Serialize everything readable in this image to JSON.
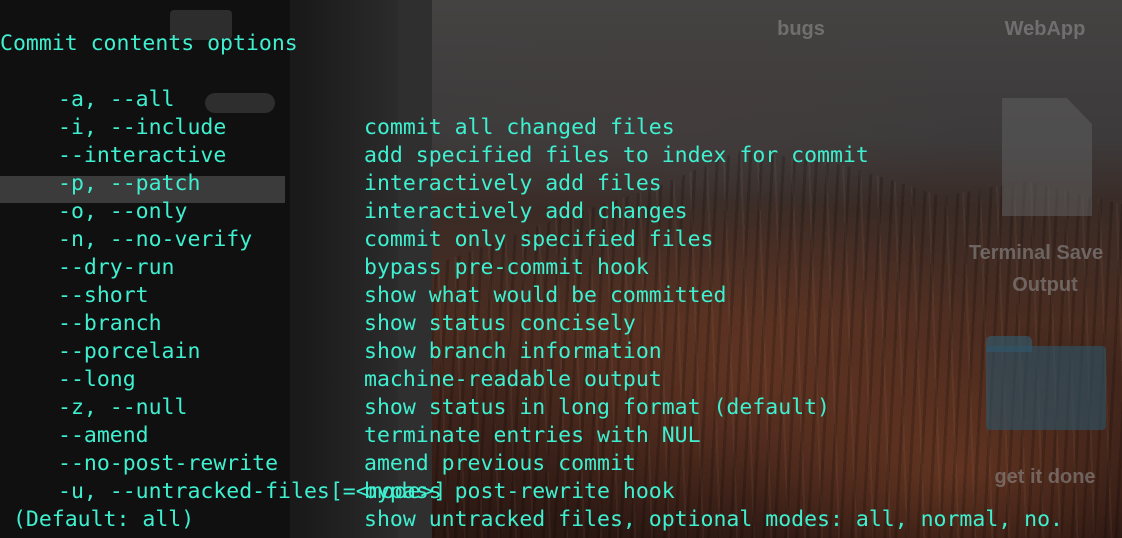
{
  "desktop": {
    "icons": [
      {
        "label": "bugs"
      },
      {
        "label": "WebApp"
      },
      {
        "label_line1": "Terminal Save",
        "label_line2": "Output"
      },
      {
        "label": "get it done"
      }
    ]
  },
  "terminal": {
    "heading": "Commit contents options",
    "options": [
      {
        "flag": "-a, --all",
        "desc": "commit all changed files"
      },
      {
        "flag": "-i, --include",
        "desc": "add specified files to index for commit"
      },
      {
        "flag": "--interactive",
        "desc": "interactively add files"
      },
      {
        "flag": "-p, --patch",
        "desc": "interactively add changes"
      },
      {
        "flag": "-o, --only",
        "desc": "commit only specified files"
      },
      {
        "flag": "-n, --no-verify",
        "desc": "bypass pre-commit hook"
      },
      {
        "flag": "--dry-run",
        "desc": "show what would be committed"
      },
      {
        "flag": "--short",
        "desc": "show status concisely"
      },
      {
        "flag": "--branch",
        "desc": "show branch information"
      },
      {
        "flag": "--porcelain",
        "desc": "machine-readable output"
      },
      {
        "flag": "--long",
        "desc": "show status in long format (default)"
      },
      {
        "flag": "-z, --null",
        "desc": "terminate entries with NUL"
      },
      {
        "flag": "--amend",
        "desc": "amend previous commit"
      },
      {
        "flag": "--no-post-rewrite",
        "desc": "bypass post-rewrite hook"
      }
    ],
    "untracked_flag": "-u, --untracked-files[=<mode>]",
    "untracked_desc": "show untracked files, optional modes: all, normal, no.",
    "default_note": " (Default: all)",
    "text_color": "#3ef0cf"
  }
}
